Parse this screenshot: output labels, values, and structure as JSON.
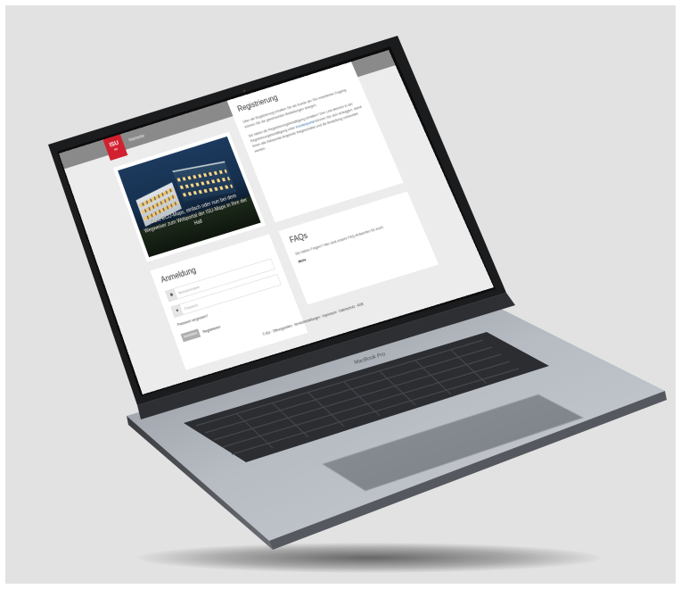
{
  "site": {
    "logo_text": "ISU",
    "logo_sub": "ISU",
    "nav_label": "Startseite"
  },
  "hero": {
    "caption": "Ganz ECO-Maps, einfach oder nun bei dem Wegweiser zum Webportal der ISU-Maps in Ihre der Hall"
  },
  "register": {
    "title": "Registrierung",
    "p1": "Über die Registrierung erhalten Sie als Kunde der ISU erweiterten Zugang, können Sie die gewünschten Bestellungen anlegen.",
    "p2a": "Sie haben die Registrierungsbestätigung erhalten? Den Link-Bereich in der Registrierungsbestätigung unter ",
    "p2_link": "Kundenportal",
    "p2b": " können Sie sich einloggen, damit Ihnen alle Webportal-Angebote freigeschaltet und die Bestellung vorbereitet werden."
  },
  "faq": {
    "title": "FAQs",
    "text": "Sie haben Fragen? Hier sind unsere FAQ-Antworten für euch:",
    "more": "Mehr"
  },
  "login": {
    "title": "Anmeldung",
    "username_icon": "user-icon",
    "username_placeholder": "Benutzername",
    "password_icon": "lock-icon",
    "password_placeholder": "Passwort",
    "forgot": "Passwort vergessen?",
    "login_button": "Anmelden",
    "register_button": "Registrieren"
  },
  "footer": {
    "text": "© ISU · Öffnungszeiten · Servicebestellungen · Impressum · Datenschutz · AGB"
  },
  "laptop": {
    "keyboard_brand": "MacBook Pro"
  },
  "colors": {
    "brand_red": "#d1202f",
    "header_gray": "#8a8a8a",
    "background": "#e2e2e2"
  }
}
